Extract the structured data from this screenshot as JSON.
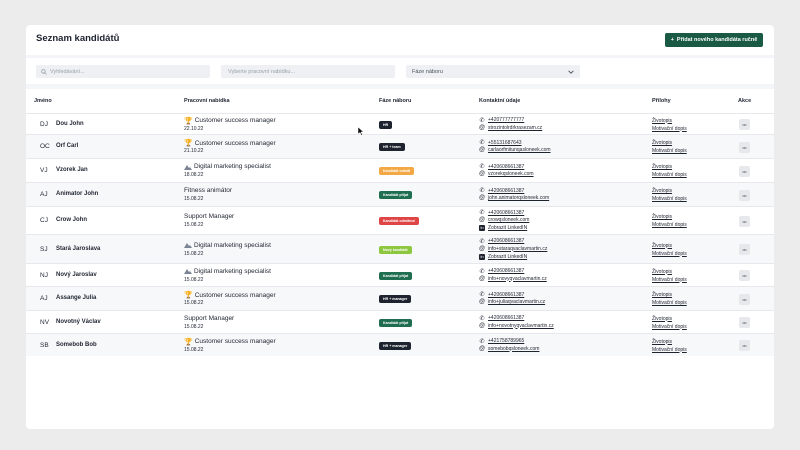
{
  "header": {
    "title": "Seznam kandidátů",
    "add_button_label": "Přidat nového kandidáta ručně",
    "add_icon": "plus-icon"
  },
  "filters": {
    "search_placeholder": "Vyhledávání...",
    "offer_placeholder": "Vyberte pracovní nabídku...",
    "phase_label": "Fáze náboru"
  },
  "columns": {
    "name": "Jméno",
    "offer": "Pracovní nabídka",
    "phase": "Fáze náboru",
    "contact": "Kontaktní údaje",
    "attachments": "Přílohy",
    "actions": "Akce"
  },
  "colors": {
    "accent": "#1a5a45",
    "badge_dark": "#1e2330",
    "badge_orange": "#f2a945",
    "badge_green": "#1f6e50",
    "badge_red": "#e04545",
    "badge_lime": "#8dc63f"
  },
  "candidates": [
    {
      "initials": "DJ",
      "name": "Dou John",
      "offer": "Customer success manager",
      "offer_icon": "trophy-icon",
      "date": "22.10.22",
      "phase": "HR",
      "phase_color": "#1e2330",
      "contacts": [
        {
          "type": "phone",
          "value": "+420777777777"
        },
        {
          "type": "email",
          "value": "strozintolrdrkrasezam.cz"
        }
      ],
      "attachments": [
        "Životopis",
        "Motivační dopis"
      ]
    },
    {
      "initials": "OC",
      "name": "Orf Carl",
      "offer": "Customer success manager",
      "offer_icon": "trophy-icon",
      "date": "21.10.22",
      "phase": "HR + team",
      "phase_color": "#1e2330",
      "contacts": [
        {
          "type": "phone",
          "value": "+55131687643"
        },
        {
          "type": "email",
          "value": "carlaorfmitunqasloneek.com"
        }
      ],
      "attachments": [
        "Životopis",
        "Motivační dopis"
      ]
    },
    {
      "initials": "VJ",
      "name": "Vzorek Jan",
      "offer": "Digital marketing specialist",
      "offer_icon": "mountain-icon",
      "date": "18.08.22",
      "phase": "Kandidát odmítl",
      "phase_color": "#f2a945",
      "contacts": [
        {
          "type": "phone",
          "value": "+420608661387"
        },
        {
          "type": "email",
          "value": "vzorekqsloneek.com"
        }
      ],
      "attachments": [
        "Životopis",
        "Motivační dopis"
      ]
    },
    {
      "initials": "AJ",
      "name": "Animator John",
      "offer": "Fitness animátor",
      "offer_icon": "",
      "date": "15.08.22",
      "phase": "Kandidát přijat",
      "phase_color": "#1f6e50",
      "contacts": [
        {
          "type": "phone",
          "value": "+420608661387"
        },
        {
          "type": "email",
          "value": "john.animatorqsloneek.com"
        }
      ],
      "attachments": [
        "Životopis",
        "Motivační dopis"
      ]
    },
    {
      "initials": "CJ",
      "name": "Crow John",
      "offer": "Support Manager",
      "offer_icon": "",
      "date": "15.08.22",
      "phase": "Kandidát odmítnut",
      "phase_color": "#e04545",
      "contacts": [
        {
          "type": "phone",
          "value": "+420608661387"
        },
        {
          "type": "email",
          "value": "crowqsloneek.com"
        },
        {
          "type": "linkedin",
          "value": "Zobrazit LinkedIN"
        }
      ],
      "attachments": [
        "Životopis",
        "Motivační dopis"
      ]
    },
    {
      "initials": "SJ",
      "name": "Stará Jaroslava",
      "offer": "Digital marketing specialist",
      "offer_icon": "mountain-icon",
      "date": "15.08.22",
      "phase": "Nový kandidát",
      "phase_color": "#8dc63f",
      "contacts": [
        {
          "type": "phone",
          "value": "+420608661387"
        },
        {
          "type": "email",
          "value": "info+staraqvaclavmartin.cz"
        },
        {
          "type": "linkedin",
          "value": "Zobrazit LinkedIN"
        }
      ],
      "attachments": [
        "Životopis",
        "Motivační dopis"
      ]
    },
    {
      "initials": "NJ",
      "name": "Nový Jaroslav",
      "offer": "Digital marketing specialist",
      "offer_icon": "mountain-icon",
      "date": "15.08.22",
      "phase": "Kandidát přijat",
      "phase_color": "#1f6e50",
      "contacts": [
        {
          "type": "phone",
          "value": "+420608661387"
        },
        {
          "type": "email",
          "value": "info+novyqvaclavmartin.cz"
        }
      ],
      "attachments": [
        "Životopis",
        "Motivační dopis"
      ]
    },
    {
      "initials": "AJ",
      "name": "Assange Julia",
      "offer": "Customer success manager",
      "offer_icon": "trophy-icon",
      "date": "15.08.22",
      "phase": "HR + manager",
      "phase_color": "#1e2330",
      "contacts": [
        {
          "type": "phone",
          "value": "+420608661387"
        },
        {
          "type": "email",
          "value": "info+juliaqvaclavmartin.cz"
        }
      ],
      "attachments": [
        "Životopis",
        "Motivační dopis"
      ]
    },
    {
      "initials": "NV",
      "name": "Novotný Václav",
      "offer": "Support Manager",
      "offer_icon": "",
      "date": "15.08.22",
      "phase": "Kandidát přijat",
      "phase_color": "#1f6e50",
      "contacts": [
        {
          "type": "phone",
          "value": "+420608661387"
        },
        {
          "type": "email",
          "value": "info+novotnyqvaclavmartin.cz"
        }
      ],
      "attachments": [
        "Životopis",
        "Motivační dopis"
      ]
    },
    {
      "initials": "SB",
      "name": "Somebob Bob",
      "offer": "Customer success manager",
      "offer_icon": "trophy-icon",
      "date": "15.08.22",
      "phase": "HR + manager",
      "phase_color": "#1e2330",
      "contacts": [
        {
          "type": "phone",
          "value": "+421758789965"
        },
        {
          "type": "email",
          "value": "somebobqsloneek.com"
        }
      ],
      "attachments": [
        "Životopis",
        "Motivační dopis"
      ]
    }
  ]
}
